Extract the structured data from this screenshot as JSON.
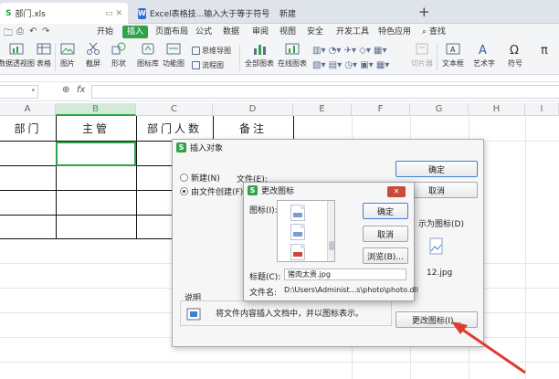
{
  "tabs": [
    {
      "title": "部门.xls",
      "controls": "▭ ✕"
    },
    {
      "title": "Excel表格技...输入大于等于符号",
      "controls": "▭"
    },
    {
      "title": "新建"
    }
  ],
  "menu": {
    "items": [
      "开始",
      "插入",
      "页面布局",
      "公式",
      "数据",
      "审阅",
      "视图",
      "安全",
      "开发工具",
      "特色应用"
    ],
    "active": "插入",
    "search": "查找"
  },
  "ribbon": {
    "left": [
      "数据透视图",
      "表格",
      "图片",
      "截屏",
      "形状",
      "图标库",
      "功能图",
      "全部图表",
      "在线图表",
      "文本框",
      "艺术字",
      "符号"
    ],
    "small": [
      "思维导图",
      "流程图"
    ],
    "disabled": "切片器"
  },
  "formula_bar": {
    "fx": "fx"
  },
  "sheet": {
    "columns": [
      "A",
      "B",
      "C",
      "D",
      "E",
      "F",
      "G",
      "H",
      "I"
    ],
    "selected_column": "B",
    "headers": [
      "部门",
      "主管",
      "部门人数",
      "备注"
    ]
  },
  "insert_object_dialog": {
    "title": "插入对象",
    "radio_new": "新建(N)",
    "radio_from_file": "由文件创建(F)",
    "file_label": "文件(E):",
    "ok": "确定",
    "cancel": "取消",
    "display_as_icon": "示为图标(D)",
    "icon_caption": "12.jpg",
    "explain_label": "说明",
    "explain_text": "将文件内容插入文档中，并以图标表示。",
    "change_icon_button": "更改图标(I)..."
  },
  "change_icon_dialog": {
    "title": "更改图标",
    "icon_label": "图标(I):",
    "ok": "确定",
    "cancel": "取消",
    "browse": "浏览(B)...",
    "caption_label": "标题(C):",
    "caption_value": "猪肉太贵.jpg",
    "filename_label": "文件名:",
    "filename_value": "D:\\Users\\Administ...s\\photo\\photo.dll"
  },
  "colors": {
    "accent": "#2fa24b",
    "arrow": "#e03a2f",
    "close": "#c84a3a"
  }
}
